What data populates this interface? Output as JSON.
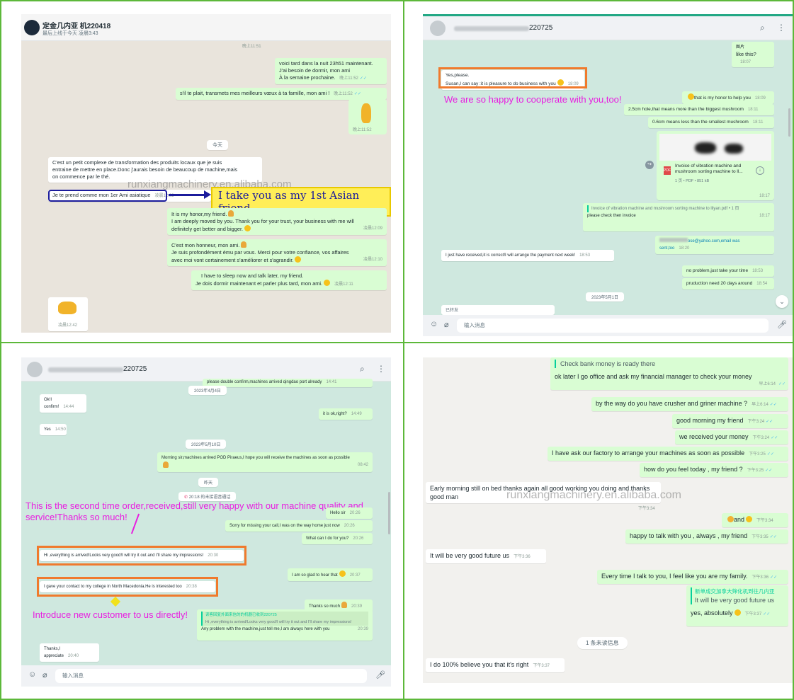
{
  "panel1": {
    "contact_name": "定金几内亚            机220418",
    "contact_status": "最后上线于今天 凌晨3:43",
    "top_time": "晚上11:51",
    "messages": [
      {
        "lines": [
          "voici tard dans la nuit 23h51 maintenant.",
          "J'ai besoin de dormir, mon ami",
          "À la semaine prochaine."
        ],
        "time": "晚上11:52"
      },
      {
        "lines": [
          "s'il te plait, transmets mes meilleurs vœux à ta famille, mon ami !"
        ],
        "time": "晚上11:52"
      },
      {
        "lines": [
          ""
        ],
        "time": "晚上11:52"
      },
      {
        "lines": [
          "C'est un petit complexe de transformation des produits locaux que je suis",
          "entraine de mettre en place.Donc j'aurais besoin de beaucoup de machine,mais",
          "on commence par le thé."
        ],
        "time": "凌晨12:03"
      },
      {
        "lines": [
          "Je te prend comme mon 1er Ami asiatique"
        ],
        "time": "凌晨12:03"
      },
      {
        "lines": [
          "It is my honor,my friend.",
          "I am deeply moved by you. Thank you for your trust, your business with me will",
          "definitely get better and bigger."
        ],
        "time": "凌晨12:09"
      },
      {
        "lines": [
          "C'est mon honneur, mon ami.",
          "Je suis profondément ému par vous. Merci pour votre confiance, vos affaires",
          "avec moi vont certainement s'améliorer et s'agrandir."
        ],
        "time": "凌晨12:10"
      },
      {
        "lines": [
          "I have to sleep now and talk later,  my friend.",
          "Je dois dormir maintenant et parler plus tard, mon ami."
        ],
        "time": "凌晨12:11"
      },
      {
        "lines": [
          ""
        ],
        "time": "凌晨12:42"
      }
    ],
    "date_today": "今天",
    "watermark": "runxiangmachinery.en.alibaba.com",
    "highlight": "I take you as my 1st Asian friend."
  },
  "panel2": {
    "contact_name": "220725",
    "top_label": "图片",
    "top_msg": "like this?",
    "top_time": "18:07",
    "boxed_msg": {
      "lines": [
        "Yes,please.",
        "Susan,I can say :it is pleasure to do business with you"
      ],
      "time": "18:09"
    },
    "overlay": "We are so happy to cooperate with you,too!",
    "out_msgs": [
      {
        "text": "that is my honor to help you",
        "time": "18:09"
      },
      {
        "text": "2.5cm hole,that means more than the biggest mushroom",
        "time": "18:11"
      },
      {
        "text": "0.6cm means less than the smallest mushroom",
        "time": "18:11"
      }
    ],
    "pdf": {
      "title": "Invoice of vibration machine and mushroom sorting machine to ll...",
      "meta": "1 页 • PDF • 851 kB",
      "time": "18:17"
    },
    "pdf_reply": {
      "quote": "Invoice of vibration machine and mushroom sorting machine to lliyan.pdf • 1 页",
      "text": "please check then invoice",
      "time": "18:17"
    },
    "email_msg": {
      "text": "ose@yahoo.com,email was sent,too",
      "time": "18:20"
    },
    "in_msg": {
      "text": "I just have received,it is correct!I will arrange the payment next week!",
      "time": "18:53"
    },
    "out_msgs2": [
      {
        "text": "no problem,just take your time",
        "time": "18:53"
      },
      {
        "text": "pruduction need 20 days around",
        "time": "18:54"
      }
    ],
    "date": "2023年5月1日",
    "forwarded": "已转发",
    "input_placeholder": "输入消息"
  },
  "panel3": {
    "contact_name": "220725",
    "top_partial": "please double confirm,machines arrived qingdao port already",
    "top_time": "14:41",
    "date1": "2023年4月4日",
    "msgs": [
      {
        "dir": "in",
        "text": "Ok!I confirm!",
        "time": "14:44"
      },
      {
        "dir": "out",
        "text": "it is ok,right?",
        "time": "14:49"
      },
      {
        "dir": "in",
        "text": "Yes",
        "time": "14:50"
      }
    ],
    "date2": "2023年5月10日",
    "arrival": {
      "text": "Morning sir,machines arrived POD Piraeus,I hope you will receive the machines as soon as possible",
      "time": "08:42"
    },
    "date3": "昨天",
    "missed_call": "20:18 的未接语音通话",
    "overlay1": "This is the second time order,received,still very happy with our machine quality and",
    "overlay2": "service!Thanks so much!",
    "hello": {
      "text": "Hello sir",
      "time": "20:26"
    },
    "sorry": {
      "text": "Sorry for missing your call,I was on the way home just now",
      "time": "20:26"
    },
    "whatcan": {
      "text": "What can I do for you?",
      "time": "20:26"
    },
    "arrived": {
      "text": "Hi ,everything is arrived!Looks very good!I will try it out and I'll share my impressions!",
      "time": "20:30"
    },
    "glad": {
      "text": "I am so glad to hear that",
      "time": "20:37"
    },
    "contact": {
      "text": "I gave your contact to my college in North Macedonia.He is interested too",
      "time": "20:38"
    },
    "thanks": {
      "text": "Thanks so much",
      "time": "20:39"
    },
    "overlay3": "Introduce new customer to us directly!",
    "quote_title": "读客回复外面来信的的机器已收到220725",
    "quote_text": "Hi ,everything is arrived!Looks very good!I will try it out and I'll share my impressions!",
    "anyproblem": {
      "text": "Any problem with the machine,just tell me,I am always here with you",
      "time": "20:39"
    },
    "appreciate": {
      "text": "Thanks,I appreciate",
      "time": "20:40"
    },
    "input_placeholder": "输入消息"
  },
  "panel4": {
    "quote_line": "Check bank money is ready there",
    "msgs": [
      {
        "dir": "out",
        "text": "ok later I go office and ask my financial manager to check your money",
        "time": "早上6:14"
      },
      {
        "dir": "out",
        "text": "by the way do you have crusher and griner machine ?",
        "time": "早上6:14"
      },
      {
        "dir": "out",
        "text": "good morning  my friend",
        "time": "下午3:24"
      },
      {
        "dir": "out",
        "text": "we received your money",
        "time": "下午3:24"
      },
      {
        "dir": "out",
        "text": "I have ask our factory to arrange your machines as soon as possible",
        "time": "下午3:25"
      },
      {
        "dir": "out",
        "text": "how do you feel today , my friend  ?",
        "time": "下午3:25"
      }
    ],
    "early": [
      "Early morning still on bed thanks again all good working you doing and thanks",
      "good man"
    ],
    "early_time": "下午3:34",
    "watermark": "runxiangmachinery.en.alibaba.com",
    "and_msg": {
      "text": "and",
      "time": "下午3:34"
    },
    "happy": {
      "text": "happy to talk with you , always , my friend",
      "time": "下午3:35"
    },
    "future": {
      "text": "It will be very good future us",
      "time": "下午3:36"
    },
    "family": {
      "text": "Every time I talk to you, I feel like you are my family.",
      "time": "下午3:36"
    },
    "quote_name": "新单成交加拿大筛化机到往几内亚",
    "quote_text": "It will be very good future us",
    "yes_msg": {
      "text": "yes, absolutely",
      "time": "下午3:37"
    },
    "unread": "1 条未读信息",
    "believe": {
      "text": "I do 100% believe you that it's right",
      "time": "下午3:37"
    }
  }
}
